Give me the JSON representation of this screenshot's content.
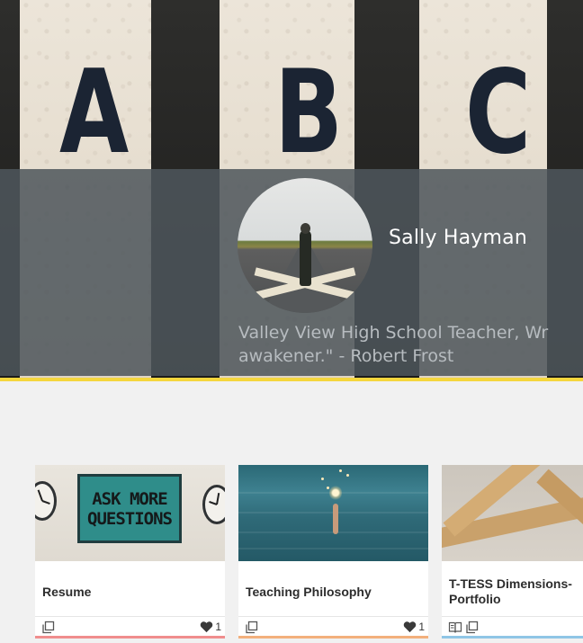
{
  "profile": {
    "name": "Sally Hayman",
    "bio_line1": "Valley View High School Teacher, Wr",
    "bio_line2": "awakener.\" - Robert Frost"
  },
  "banner": {
    "letters": [
      "A",
      "B",
      "C"
    ]
  },
  "cards": [
    {
      "title": "Resume",
      "title_line2": "",
      "thumb_text": [
        "ASK MORE",
        "QUESTIONS"
      ],
      "likes": "1",
      "accent_color": "#f08d8d",
      "icons": [
        "copy-icon",
        "heart-icon"
      ]
    },
    {
      "title": "Teaching Philosophy",
      "title_line2": "",
      "likes": "1",
      "accent_color": "#f3b07c",
      "icons": [
        "copy-icon",
        "heart-icon"
      ]
    },
    {
      "title": "T-TESS Dimensions-",
      "title_line2": "Portfolio",
      "likes": "",
      "accent_color": "#8fc6e6",
      "icons": [
        "book-icon",
        "copy-icon"
      ]
    }
  ],
  "colors": {
    "accent_bar": "#f5d63d",
    "overlay": "#4e565c",
    "name_text": "#ffffff",
    "bio_text": "#b7bcc0"
  }
}
